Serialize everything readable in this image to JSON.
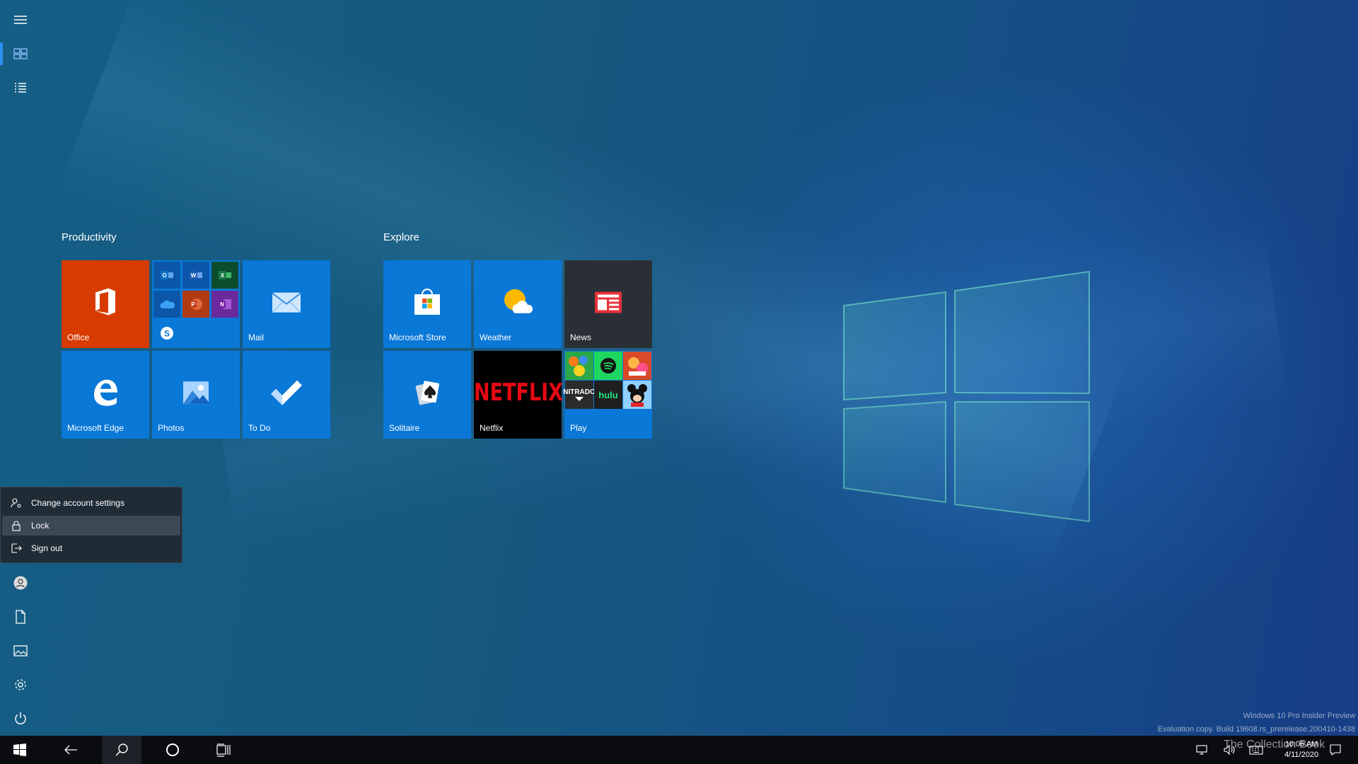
{
  "groups": {
    "productivity": {
      "title": "Productivity"
    },
    "explore": {
      "title": "Explore"
    }
  },
  "tiles": {
    "office": {
      "label": "Office"
    },
    "mail": {
      "label": "Mail"
    },
    "edge": {
      "label": "Microsoft Edge"
    },
    "photos": {
      "label": "Photos"
    },
    "todo": {
      "label": "To Do"
    },
    "store": {
      "label": "Microsoft Store"
    },
    "weather": {
      "label": "Weather"
    },
    "news": {
      "label": "News"
    },
    "solitaire": {
      "label": "Solitaire"
    },
    "netflix": {
      "label": "Netflix",
      "wordmark": "NETFLIX"
    },
    "play": {
      "label": "Play",
      "nitrado": "NITRADO",
      "hulu": "hulu"
    }
  },
  "folder_apps": [
    "Outlook",
    "Word",
    "Excel",
    "OneDrive",
    "PowerPoint",
    "OneNote",
    "Skype"
  ],
  "account_menu": {
    "items": [
      {
        "label": "Change account settings",
        "icon": "account-settings-icon"
      },
      {
        "label": "Lock",
        "icon": "lock-icon",
        "selected": true
      },
      {
        "label": "Sign out",
        "icon": "sign-out-icon"
      }
    ]
  },
  "tray": {
    "time": "10:06 AM",
    "date": "4/11/2020"
  },
  "watermark": {
    "edition": "Windows 10 Pro Insider Preview",
    "build": "Evaluation copy. Build 19608.rs_prerelease.200410-1438",
    "collector": "The Collection Book"
  },
  "colors": {
    "accent": "#0a78d7",
    "office": "#d83b01",
    "news": "#2a2f36",
    "netflix_bg": "#000000",
    "netflix_red": "#e50914",
    "flyout_bg": "#1f2b35"
  }
}
